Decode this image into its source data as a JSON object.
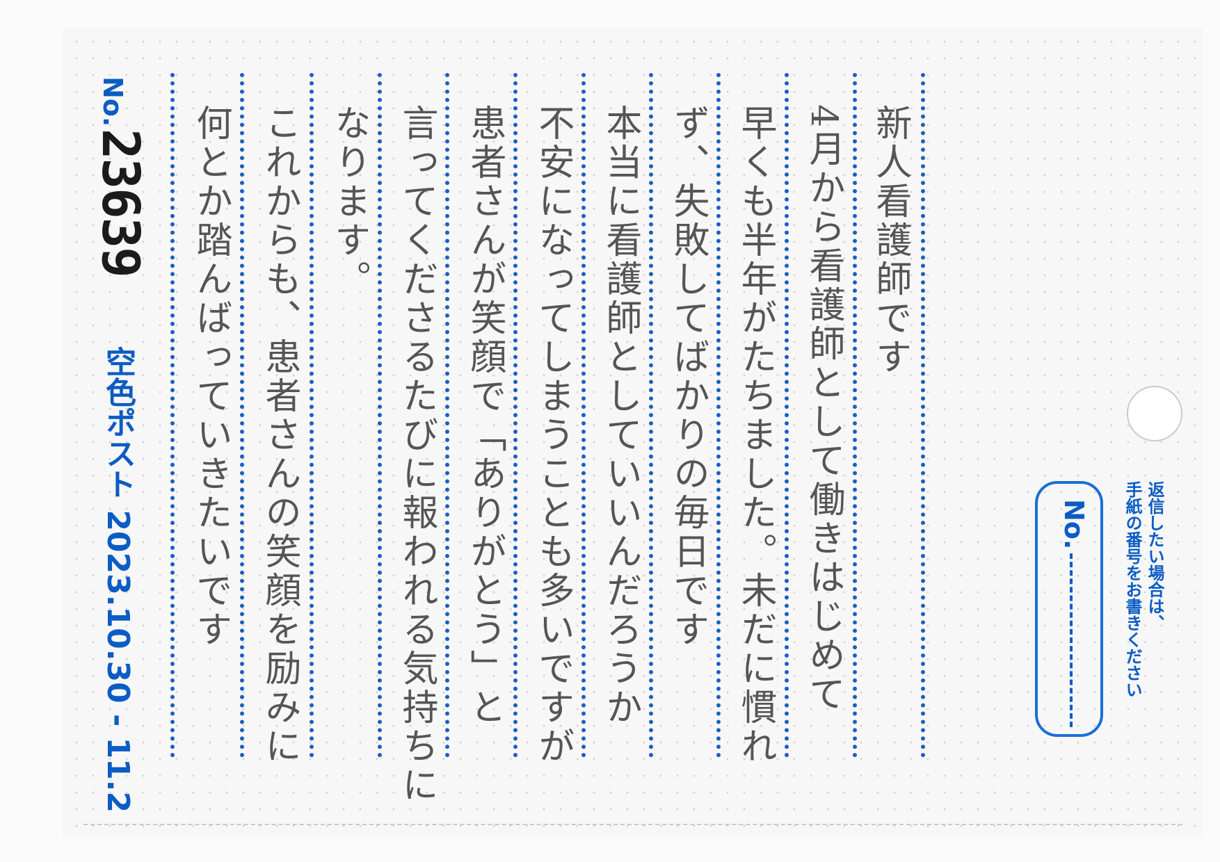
{
  "header": {
    "no_label": "No.",
    "no_value": "23639",
    "brand_and_dates": "空色ポスト 2023.10.30 - 11.2"
  },
  "letter": {
    "lines": [
      "新人看護師です",
      "4月から看護師として働きはじめて",
      "早くも半年がたちました。未だに慣れ",
      "ず、失敗してばかりの毎日です",
      "本当に看護師としていいんだろうか",
      "不安になってしまうことも多いですが",
      "患者さんが笑顔で「ありがとう」と",
      "言ってくださるたびに報われる気持ちに",
      "なります。",
      "これからも、患者さんの笑顔を励みに",
      "何とか踏んばっていきたいです"
    ]
  },
  "reply": {
    "note_line1": "返信したい場合は、",
    "note_line2": "手紙の番号をお書きください",
    "box_label": "No."
  }
}
